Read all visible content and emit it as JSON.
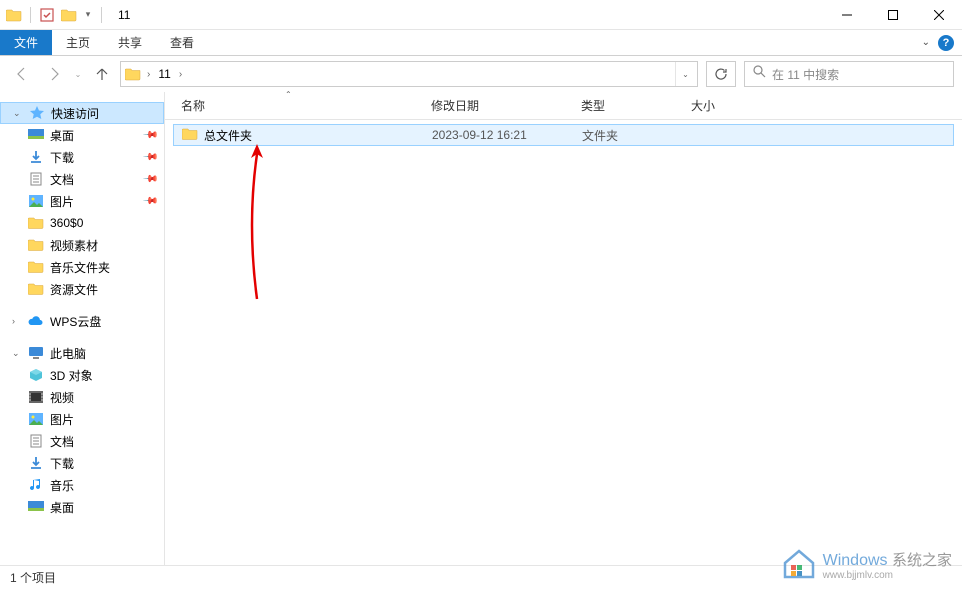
{
  "title": "11",
  "ribbon": {
    "file": "文件",
    "home": "主页",
    "share": "共享",
    "view": "查看"
  },
  "nav": {
    "current_folder": "11",
    "search_placeholder": "在 11 中搜索"
  },
  "columns": {
    "name": "名称",
    "modified": "修改日期",
    "type": "类型",
    "size": "大小"
  },
  "sidebar": {
    "quick_access": "快速访问",
    "pinned": [
      {
        "label": "桌面",
        "icon": "desktop"
      },
      {
        "label": "下载",
        "icon": "download"
      },
      {
        "label": "文档",
        "icon": "document"
      },
      {
        "label": "图片",
        "icon": "picture"
      }
    ],
    "recent": [
      {
        "label": "360$0"
      },
      {
        "label": "视频素材"
      },
      {
        "label": "音乐文件夹"
      },
      {
        "label": "资源文件"
      }
    ],
    "wps": "WPS云盘",
    "this_pc": "此电脑",
    "pc_items": [
      {
        "label": "3D 对象",
        "icon": "3d"
      },
      {
        "label": "视频",
        "icon": "video"
      },
      {
        "label": "图片",
        "icon": "picture"
      },
      {
        "label": "文档",
        "icon": "document"
      },
      {
        "label": "下载",
        "icon": "download"
      },
      {
        "label": "音乐",
        "icon": "music"
      },
      {
        "label": "桌面",
        "icon": "desktop"
      }
    ]
  },
  "files": [
    {
      "name": "总文件夹",
      "modified": "2023-09-12 16:21",
      "type": "文件夹",
      "size": ""
    }
  ],
  "status": "1 个项目",
  "watermark": {
    "brand": "Windows",
    "brand_suffix": "系统之家",
    "url": "www.bjjmlv.com"
  }
}
